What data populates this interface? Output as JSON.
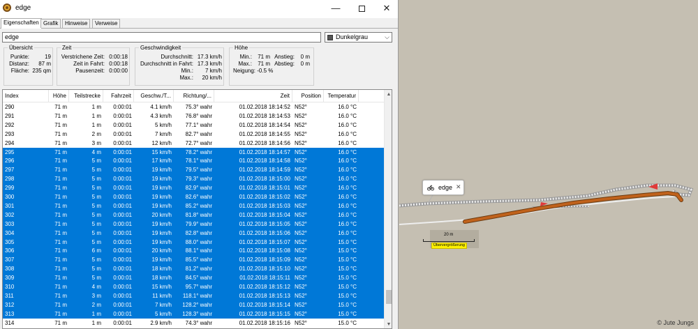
{
  "window": {
    "title": "edge",
    "minimize_glyph": "—",
    "close_glyph": "✕"
  },
  "tabs": [
    {
      "label": "Eigenschaften",
      "active": true
    },
    {
      "label": "Grafik"
    },
    {
      "label": "Hinweise"
    },
    {
      "label": "Verweise"
    }
  ],
  "name_value": "edge",
  "color_select": {
    "value": "Dunkelgrau",
    "swatch": "#555555"
  },
  "overview": {
    "title": "Übersicht",
    "rows": [
      {
        "k": "Punkte:",
        "v": "19"
      },
      {
        "k": "Distanz:",
        "v": "87 m"
      },
      {
        "k": "Fläche:",
        "v": "235 qm"
      }
    ]
  },
  "time": {
    "title": "Zeit",
    "rows": [
      {
        "k": "Verstrichene Zeit:",
        "v": "0:00:18"
      },
      {
        "k": "Zeit in Fahrt:",
        "v": "0:00:18"
      },
      {
        "k": "Pausenzeit:",
        "v": "0:00:00"
      }
    ]
  },
  "speed": {
    "title": "Geschwindigkeit",
    "rows": [
      {
        "k": "Durchschnitt:",
        "v": "17.3 km/h"
      },
      {
        "k": "Durchschnitt in Fahrt:",
        "v": "17.3 km/h"
      },
      {
        "k": "Min.:",
        "v": "7 km/h"
      },
      {
        "k": "Max.:",
        "v": "20 km/h"
      }
    ]
  },
  "height": {
    "title": "Höhe",
    "min": {
      "k": "Min.:",
      "v": "71 m"
    },
    "max": {
      "k": "Max.:",
      "v": "71 m"
    },
    "ascent": {
      "k": "Anstieg:",
      "v": "0 m"
    },
    "descent": {
      "k": "Abstieg:",
      "v": "0 m"
    },
    "slope": "Neigung:  -0.5 %"
  },
  "table": {
    "columns": [
      "Index",
      "Höhe",
      "Teilstrecke",
      "Fahrzeit",
      "Geschw./T...",
      "Richtung/...",
      "Zeit",
      "Position",
      "Temperatur"
    ],
    "rows": [
      {
        "i": "290",
        "h": "71 m",
        "t": "1 m",
        "f": "0:00:01",
        "g": "4.1 km/h",
        "r": "75.3° wahr",
        "z": "01.02.2018 18:14:52",
        "p": "N52°",
        "c": "16.0 °C",
        "sel": false
      },
      {
        "i": "291",
        "h": "71 m",
        "t": "1 m",
        "f": "0:00:01",
        "g": "4.3 km/h",
        "r": "76.8° wahr",
        "z": "01.02.2018 18:14:53",
        "p": "N52°",
        "c": "16.0 °C",
        "sel": false
      },
      {
        "i": "292",
        "h": "71 m",
        "t": "1 m",
        "f": "0:00:01",
        "g": "5 km/h",
        "r": "77.1° wahr",
        "z": "01.02.2018 18:14:54",
        "p": "N52°",
        "c": "16.0 °C",
        "sel": false
      },
      {
        "i": "293",
        "h": "71 m",
        "t": "2 m",
        "f": "0:00:01",
        "g": "7 km/h",
        "r": "82.7° wahr",
        "z": "01.02.2018 18:14:55",
        "p": "N52°",
        "c": "16.0 °C",
        "sel": false
      },
      {
        "i": "294",
        "h": "71 m",
        "t": "3 m",
        "f": "0:00:01",
        "g": "12 km/h",
        "r": "72.7° wahr",
        "z": "01.02.2018 18:14:56",
        "p": "N52°",
        "c": "16.0 °C",
        "sel": false
      },
      {
        "i": "295",
        "h": "71 m",
        "t": "4 m",
        "f": "0:00:01",
        "g": "15 km/h",
        "r": "78.2° wahr",
        "z": "01.02.2018 18:14:57",
        "p": "N52°",
        "c": "16.0 °C",
        "sel": true
      },
      {
        "i": "296",
        "h": "71 m",
        "t": "5 m",
        "f": "0:00:01",
        "g": "17 km/h",
        "r": "78.1° wahr",
        "z": "01.02.2018 18:14:58",
        "p": "N52°",
        "c": "16.0 °C",
        "sel": true
      },
      {
        "i": "297",
        "h": "71 m",
        "t": "5 m",
        "f": "0:00:01",
        "g": "19 km/h",
        "r": "79.5° wahr",
        "z": "01.02.2018 18:14:59",
        "p": "N52°",
        "c": "16.0 °C",
        "sel": true
      },
      {
        "i": "298",
        "h": "71 m",
        "t": "5 m",
        "f": "0:00:01",
        "g": "19 km/h",
        "r": "79.3° wahr",
        "z": "01.02.2018 18:15:00",
        "p": "N52°",
        "c": "16.0 °C",
        "sel": true
      },
      {
        "i": "299",
        "h": "71 m",
        "t": "5 m",
        "f": "0:00:01",
        "g": "19 km/h",
        "r": "82.9° wahr",
        "z": "01.02.2018 18:15:01",
        "p": "N52°",
        "c": "16.0 °C",
        "sel": true
      },
      {
        "i": "300",
        "h": "71 m",
        "t": "5 m",
        "f": "0:00:01",
        "g": "19 km/h",
        "r": "82.6° wahr",
        "z": "01.02.2018 18:15:02",
        "p": "N52°",
        "c": "16.0 °C",
        "sel": true
      },
      {
        "i": "301",
        "h": "71 m",
        "t": "5 m",
        "f": "0:00:01",
        "g": "19 km/h",
        "r": "85.2° wahr",
        "z": "01.02.2018 18:15:03",
        "p": "N52°",
        "c": "16.0 °C",
        "sel": true
      },
      {
        "i": "302",
        "h": "71 m",
        "t": "5 m",
        "f": "0:00:01",
        "g": "20 km/h",
        "r": "81.8° wahr",
        "z": "01.02.2018 18:15:04",
        "p": "N52°",
        "c": "16.0 °C",
        "sel": true
      },
      {
        "i": "303",
        "h": "71 m",
        "t": "5 m",
        "f": "0:00:01",
        "g": "19 km/h",
        "r": "79.9° wahr",
        "z": "01.02.2018 18:15:05",
        "p": "N52°",
        "c": "16.0 °C",
        "sel": true
      },
      {
        "i": "304",
        "h": "71 m",
        "t": "5 m",
        "f": "0:00:01",
        "g": "19 km/h",
        "r": "82.8° wahr",
        "z": "01.02.2018 18:15:06",
        "p": "N52°",
        "c": "16.0 °C",
        "sel": true
      },
      {
        "i": "305",
        "h": "71 m",
        "t": "5 m",
        "f": "0:00:01",
        "g": "19 km/h",
        "r": "88.0° wahr",
        "z": "01.02.2018 18:15:07",
        "p": "N52°",
        "c": "15.0 °C",
        "sel": true
      },
      {
        "i": "306",
        "h": "71 m",
        "t": "6 m",
        "f": "0:00:01",
        "g": "20 km/h",
        "r": "88.1° wahr",
        "z": "01.02.2018 18:15:08",
        "p": "N52°",
        "c": "15.0 °C",
        "sel": true
      },
      {
        "i": "307",
        "h": "71 m",
        "t": "5 m",
        "f": "0:00:01",
        "g": "19 km/h",
        "r": "85.5° wahr",
        "z": "01.02.2018 18:15:09",
        "p": "N52°",
        "c": "15.0 °C",
        "sel": true
      },
      {
        "i": "308",
        "h": "71 m",
        "t": "5 m",
        "f": "0:00:01",
        "g": "18 km/h",
        "r": "81.2° wahr",
        "z": "01.02.2018 18:15:10",
        "p": "N52°",
        "c": "15.0 °C",
        "sel": true
      },
      {
        "i": "309",
        "h": "71 m",
        "t": "5 m",
        "f": "0:00:01",
        "g": "18 km/h",
        "r": "84.5° wahr",
        "z": "01.02.2018 18:15:11",
        "p": "N52°",
        "c": "15.0 °C",
        "sel": true
      },
      {
        "i": "310",
        "h": "71 m",
        "t": "4 m",
        "f": "0:00:01",
        "g": "15 km/h",
        "r": "95.7° wahr",
        "z": "01.02.2018 18:15:12",
        "p": "N52°",
        "c": "15.0 °C",
        "sel": true
      },
      {
        "i": "311",
        "h": "71 m",
        "t": "3 m",
        "f": "0:00:01",
        "g": "11 km/h",
        "r": "118.1° wahr",
        "z": "01.02.2018 18:15:13",
        "p": "N52°",
        "c": "15.0 °C",
        "sel": true
      },
      {
        "i": "312",
        "h": "71 m",
        "t": "2 m",
        "f": "0:00:01",
        "g": "7 km/h",
        "r": "128.2° wahr",
        "z": "01.02.2018 18:15:14",
        "p": "N52°",
        "c": "15.0 °C",
        "sel": true
      },
      {
        "i": "313",
        "h": "71 m",
        "t": "1 m",
        "f": "0:00:01",
        "g": "5 km/h",
        "r": "128.3° wahr",
        "z": "01.02.2018 18:15:15",
        "p": "N52°",
        "c": "15.0 °C",
        "sel": true
      },
      {
        "i": "314",
        "h": "71 m",
        "t": "1 m",
        "f": "0:00:01",
        "g": "2.9 km/h",
        "r": "74.3° wahr",
        "z": "01.02.2018 18:15:16",
        "p": "N52°",
        "c": "15.0 °C",
        "sel": false
      }
    ]
  },
  "map": {
    "callout_label": "edge",
    "callout_close": "✕",
    "scale_text": "20 m",
    "scale_badge": "Übervergrößerung",
    "copyright": "© Jute Jungs",
    "track_color": "#c0621c",
    "road_color": "#e8e8e8"
  },
  "icons": [
    "app-icon",
    "maximize-icon",
    "close-icon",
    "dropdown-arrow-icon",
    "scroll-up-icon",
    "scroll-down-icon",
    "motorbike-icon",
    "direction-arrow-icon"
  ]
}
